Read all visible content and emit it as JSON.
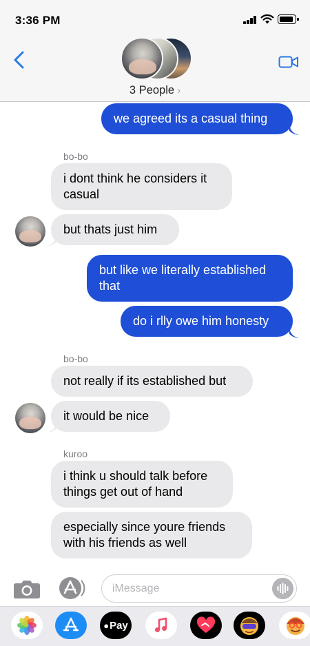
{
  "status_bar": {
    "time": "3:36 PM"
  },
  "header": {
    "group_name": "3 People",
    "group_chevron": "›"
  },
  "messages": [
    {
      "dir": "out",
      "text": "we agreed its a casual thing"
    },
    {
      "dir": "in",
      "sender": "bo-bo",
      "text": "i dont think he considers it casual"
    },
    {
      "dir": "in",
      "text": "but thats just him"
    },
    {
      "dir": "out",
      "text": "but like we literally established that"
    },
    {
      "dir": "out",
      "text": "do i rlly owe him honesty"
    },
    {
      "dir": "in",
      "sender": "bo-bo",
      "text": "not really if its established but"
    },
    {
      "dir": "in",
      "text": "it would be nice"
    },
    {
      "dir": "in",
      "sender": "kuroo",
      "text": "i think u should talk before things get out of hand"
    },
    {
      "dir": "in",
      "text": "especially since youre friends with his friends as well"
    }
  ],
  "input": {
    "placeholder": "iMessage"
  },
  "tray": {
    "pay_label": "Pay"
  },
  "colors": {
    "outgoing": "#1f4fd6",
    "incoming": "#e9e9eb",
    "accent": "#2a7ae2"
  }
}
